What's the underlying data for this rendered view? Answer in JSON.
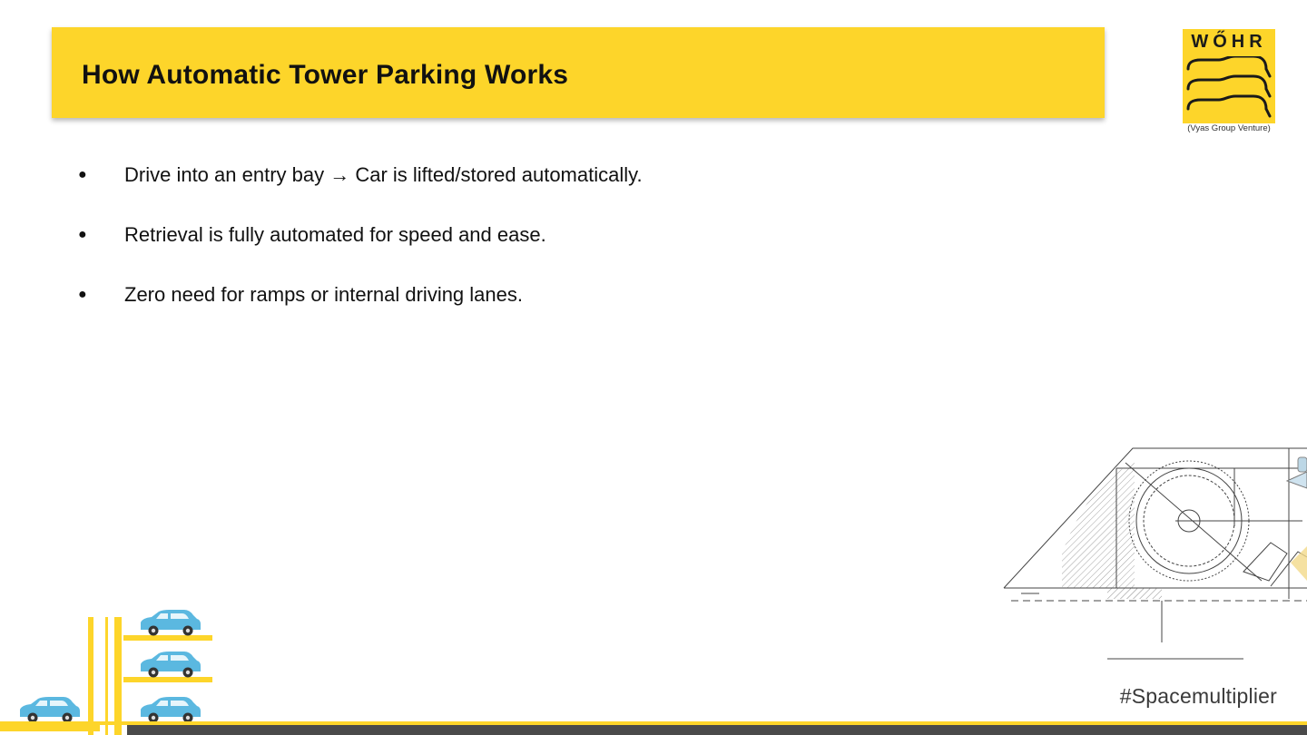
{
  "slide": {
    "title": "How Automatic Tower Parking Works",
    "bullets": [
      "Drive into an entry bay → Car is lifted/stored automatically.",
      "Retrieval is fully automated for speed and ease.",
      "Zero need for ramps or internal driving lanes."
    ],
    "bullet_symbol": "●",
    "hashtag": "#Spacemultiplier"
  },
  "logo": {
    "wordmark": "WŐHR",
    "caption": "(Vyas Group Venture)"
  },
  "colors": {
    "accent_yellow": "#fdd52a",
    "footer_dark": "#4a4a4a",
    "car_blue": "#5bb8e0",
    "text": "#111111"
  },
  "icons": [
    "wohr-logo",
    "parking-tower-illustration",
    "car-icon",
    "blueprint-drawing"
  ]
}
